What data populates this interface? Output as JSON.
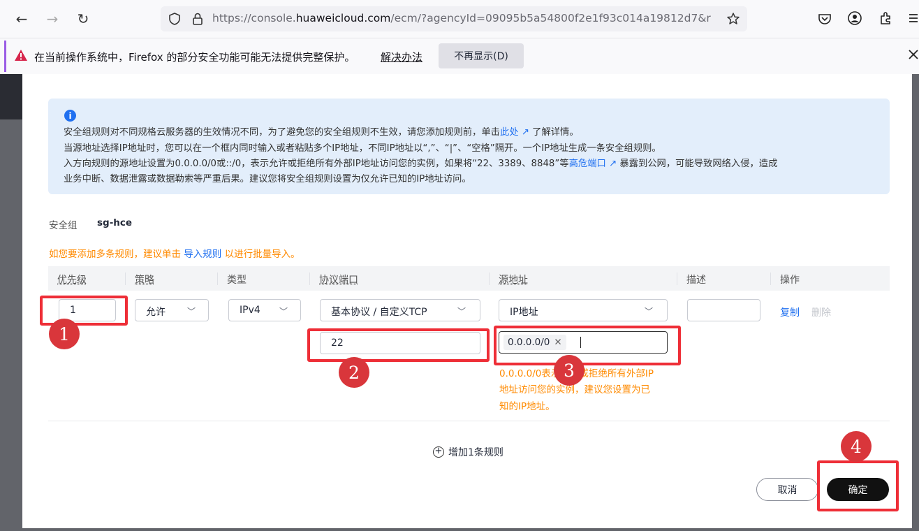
{
  "browser": {
    "back_icon": "←",
    "forward_icon": "→",
    "reload_icon": "↻",
    "url_prefix": "https://console.",
    "url_domain": "huaweicloud.com",
    "url_path": "/ecm/?agencyId=09095b5a54800f2e1f93c014a19812d7&r",
    "notification": {
      "message": "在当前操作系统中，Firefox 的部分安全功能可能无法提供完整保护。",
      "link": "解决办法",
      "button": "不再显示(D)"
    }
  },
  "dialog": {
    "info": {
      "line1_a": "安全组规则对不同规格云服务器的生效情况不同，为了避免您的安全组规则不生效，请您添加规则前，单击",
      "line1_link": "此处",
      "line1_b": "了解详情。",
      "line2": "当源地址选择IP地址时，您可以在一个框内同时输入或者粘贴多个IP地址，不同IP地址以“,”、“|”、“空格”隔开。一个IP地址生成一条安全组规则。",
      "line3_a": "入方向规则的源地址设置为0.0.0.0/0或::/0，表示允许或拒绝所有外部IP地址访问您的实例，如果将“22、3389、8848”等",
      "line3_link": "高危端口",
      "line3_b": "暴露到公网，可能导致网络入侵，造成",
      "line4": "业务中断、数据泄露或数据勒索等严重后果。建议您将安全组规则设置为仅允许已知的IP地址访问。"
    },
    "security_group_label": "安全组",
    "security_group_value": "sg-hce",
    "hint_a": "如您要添加多条规则，建议单击",
    "hint_link": "导入规则",
    "hint_b": "以进行批量导入。",
    "columns": [
      "优先级",
      "策略",
      "类型",
      "协议端口",
      "源地址",
      "描述",
      "操作"
    ],
    "row": {
      "priority": "1",
      "policy": "允许",
      "type": "IPv4",
      "protocol": "基本协议 / 自定义TCP",
      "port": "22",
      "source_type": "IP地址",
      "source_tag": "0.0.0.0/0",
      "description": "",
      "copy": "复制",
      "delete": "删除",
      "warning_line1": "0.0.0.0/0表示允许或拒绝所有外部IP",
      "warning_line2": "地址访问您的实例，建议您设置为已",
      "warning_line3": "知的IP地址。"
    },
    "add_rule": "增加1条规则",
    "cancel": "取消",
    "confirm": "确定"
  },
  "annotations": [
    "1",
    "2",
    "3",
    "4"
  ],
  "colors": {
    "accent_blue": "#2070f0",
    "warning_orange": "#ff8a00",
    "annotation_red": "#ee2e37",
    "primary_button": "#111111"
  }
}
